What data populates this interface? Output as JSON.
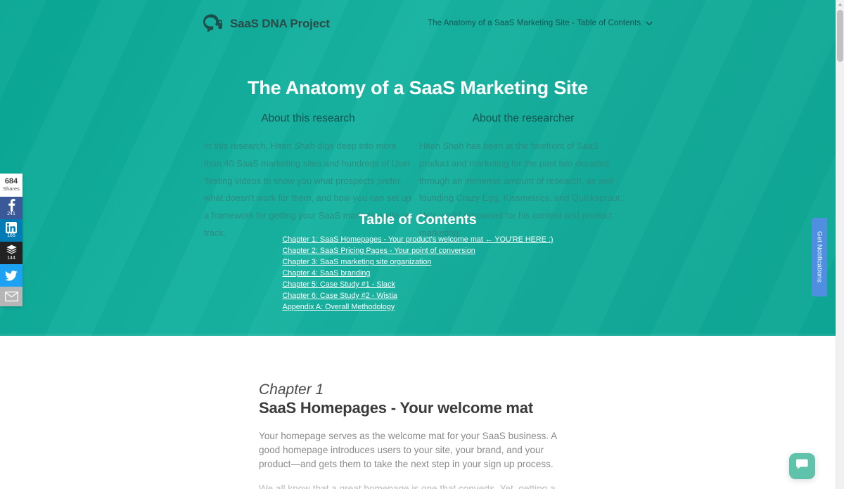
{
  "header": {
    "brand_name": "SaaS DNA Project",
    "brand_icon": "pi-logo-icon",
    "nav_toc_label": "The Anatomy of a SaaS Marketing Site - Table of Contents",
    "nav_chevron_icon": "chevron-down-icon"
  },
  "hero": {
    "title": "The Anatomy of a SaaS Marketing Site",
    "left_column": {
      "heading": "About this research",
      "body": "In this research, Hiten Shah digs deep into more than 40 SaaS marketing sites and hundreds of User Testing videos to show you what prospects prefer, what doesn't work for them, and how you can set up a framework for getting your SaaS marketing site on track."
    },
    "right_column": {
      "heading": "About the researcher",
      "body": "Hiten Shah has been at the forefront of SaaS product and marketing for the past two decades through an immense amount of research, as well founding Crazy Egg, Kissmetrics, and Quicksprout. He's world renowned for his content and product marketing."
    },
    "toc_title": "Table of Contents",
    "toc_links": [
      "Chapter 1: SaaS Homepages - Your product's welcome mat  ← YOU'RE HERE :)",
      "Chapter 2: SaaS Pricing Pages - Your point of conversion",
      "Chapter 3: SaaS marketing site organization",
      "Chapter 4: SaaS branding",
      "Chapter 5: Case Study #1 - Slack",
      "Chapter 6: Case Study #2 - Wistia",
      "Appendix A: Overall Methodology"
    ],
    "accent_color": "#12b0a0",
    "text_color": "#ffffff"
  },
  "content": {
    "chapter_kicker": "Chapter 1",
    "chapter_title": "SaaS Homepages - Your welcome mat",
    "paragraph_1": "Your homepage serves as the welcome mat for your SaaS business. A good homepage introduces users to your site, your brand, and your product—and gets them to take the next step in your sign up process.",
    "paragraph_2": "We all know that a great homepage is one that converts. Yet, getting a"
  },
  "share_rail": {
    "total_count": "684",
    "total_label": "Shares",
    "buttons": [
      {
        "name": "facebook",
        "icon": "facebook-icon",
        "count": "241",
        "color": "#3b5998"
      },
      {
        "name": "linkedin",
        "icon": "linkedin-icon",
        "count": "165",
        "color": "#007bb5"
      },
      {
        "name": "buffer",
        "icon": "buffer-icon",
        "count": "144",
        "color": "#222222"
      },
      {
        "name": "twitter",
        "icon": "twitter-icon",
        "count": "",
        "color": "#1da1f2"
      },
      {
        "name": "email",
        "icon": "envelope-icon",
        "count": "",
        "color": "#b6b6b6"
      }
    ]
  },
  "notifications_tab": {
    "label": "Get Notifications",
    "color": "#4f8fe0"
  },
  "chat_widget": {
    "icon": "chat-bubble-icon",
    "color": "#5fc3ab"
  },
  "scrollbar": {
    "up_arrow_icon": "scroll-up-arrow-icon",
    "thumb_position": "near-top"
  }
}
